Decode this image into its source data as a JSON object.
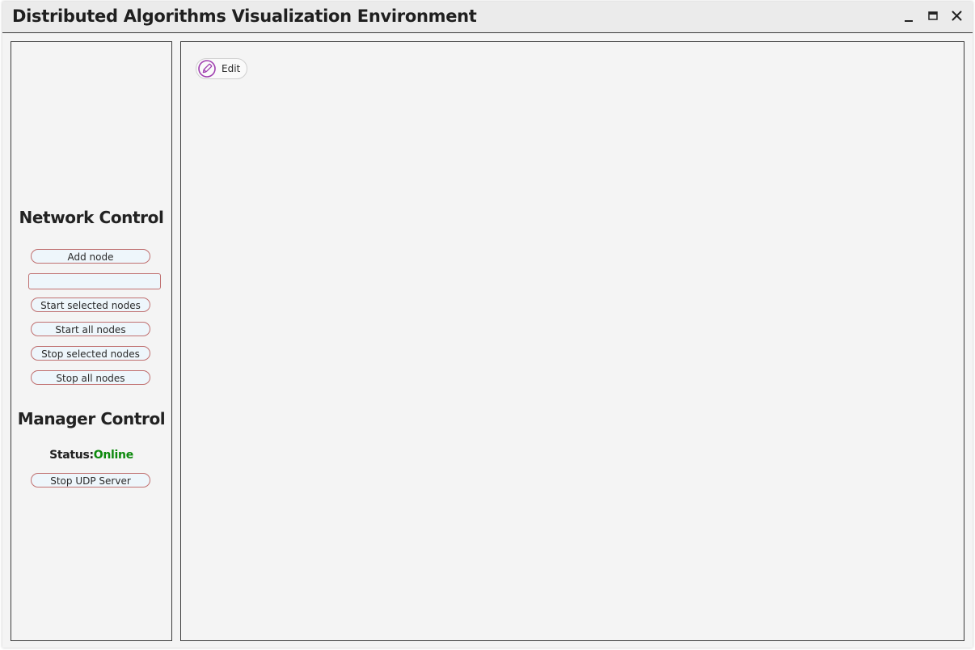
{
  "window": {
    "title": "Distributed Algorithms Visualization Environment",
    "controls": {
      "minimize_icon": "minimize-icon",
      "maximize_icon": "maximize-icon",
      "close_icon": "close-icon"
    }
  },
  "sidebar": {
    "network_control": {
      "heading": "Network Control",
      "add_node_label": "Add node",
      "node_input": {
        "value": "",
        "placeholder": ""
      },
      "start_selected_label": "Start selected nodes",
      "start_all_label": "Start all nodes",
      "stop_selected_label": "Stop selected nodes",
      "stop_all_label": "Stop all nodes"
    },
    "manager_control": {
      "heading": "Manager Control",
      "status_label": "Status:",
      "status_value": "Online",
      "status_color": "#0d8a0d",
      "stop_udp_label": "Stop UDP Server"
    }
  },
  "canvas": {
    "edit_button": {
      "label": "Edit",
      "icon": "pencil-icon",
      "icon_color": "#a040b0"
    }
  },
  "colors": {
    "button_border": "#c07070",
    "button_background": "#eef6fb",
    "panel_background": "#f4f4f4"
  }
}
